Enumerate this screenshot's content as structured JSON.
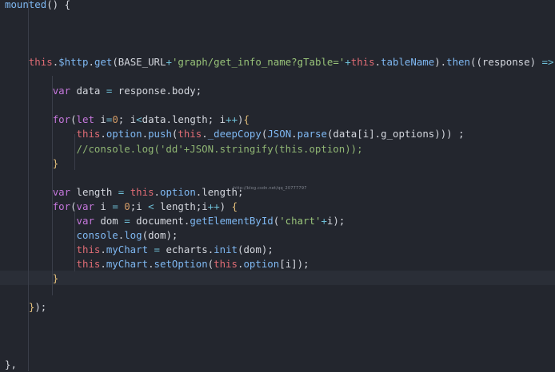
{
  "watermark": "http://blog.csdn.net/qq_20777797",
  "code_lines": [
    {
      "tokens": [
        [
          "fn",
          "mounted"
        ],
        [
          "pu",
          "() {"
        ]
      ]
    },
    {
      "tokens": []
    },
    {
      "tokens": []
    },
    {
      "tokens": []
    },
    {
      "tokens": [
        [
          "pl",
          "    "
        ],
        [
          "th",
          "this"
        ],
        [
          "pu",
          "."
        ],
        [
          "fn",
          "$http"
        ],
        [
          "pu",
          "."
        ],
        [
          "fn",
          "get"
        ],
        [
          "pu",
          "("
        ],
        [
          "pl",
          "BASE_URL"
        ],
        [
          "op",
          "+"
        ],
        [
          "st",
          "'graph/get_info_name?gTable='"
        ],
        [
          "op",
          "+"
        ],
        [
          "th",
          "this"
        ],
        [
          "pu",
          "."
        ],
        [
          "fn",
          "tableName"
        ],
        [
          "pu",
          ")."
        ],
        [
          "fn",
          "then"
        ],
        [
          "pu",
          "(("
        ],
        [
          "pl",
          "response"
        ],
        [
          "pu",
          ") "
        ],
        [
          "op",
          "=>"
        ],
        [
          "pu",
          " "
        ],
        [
          "yb",
          "{"
        ]
      ]
    },
    {
      "tokens": []
    },
    {
      "tokens": [
        [
          "pl",
          "        "
        ],
        [
          "kw",
          "var"
        ],
        [
          "pl",
          " data "
        ],
        [
          "op",
          "="
        ],
        [
          "pl",
          " response"
        ],
        [
          "pu",
          "."
        ],
        [
          "pl",
          "body"
        ],
        [
          "pu",
          ";"
        ]
      ]
    },
    {
      "tokens": []
    },
    {
      "tokens": [
        [
          "pl",
          "        "
        ],
        [
          "kw",
          "for"
        ],
        [
          "pu",
          "("
        ],
        [
          "kw",
          "let"
        ],
        [
          "pl",
          " i"
        ],
        [
          "op",
          "="
        ],
        [
          "nm",
          "0"
        ],
        [
          "pu",
          "; "
        ],
        [
          "pl",
          "i"
        ],
        [
          "op",
          "<"
        ],
        [
          "pl",
          "data"
        ],
        [
          "pu",
          "."
        ],
        [
          "pl",
          "length"
        ],
        [
          "pu",
          "; "
        ],
        [
          "pl",
          "i"
        ],
        [
          "op",
          "++"
        ],
        [
          "pu",
          ")"
        ],
        [
          "yb",
          "{"
        ]
      ]
    },
    {
      "tokens": [
        [
          "pl",
          "            "
        ],
        [
          "th",
          "this"
        ],
        [
          "pu",
          "."
        ],
        [
          "fn",
          "option"
        ],
        [
          "pu",
          "."
        ],
        [
          "fn",
          "push"
        ],
        [
          "pu",
          "("
        ],
        [
          "th",
          "this"
        ],
        [
          "pu",
          "."
        ],
        [
          "fn",
          "_deepCopy"
        ],
        [
          "pu",
          "("
        ],
        [
          "gl",
          "JSON"
        ],
        [
          "pu",
          "."
        ],
        [
          "fn",
          "parse"
        ],
        [
          "pu",
          "("
        ],
        [
          "pl",
          "data"
        ],
        [
          "pu",
          "["
        ],
        [
          "pl",
          "i"
        ],
        [
          "pu",
          "]."
        ],
        [
          "pl",
          "g_options"
        ],
        [
          "pu",
          "))) ;"
        ]
      ]
    },
    {
      "tokens": [
        [
          "pl",
          "            "
        ],
        [
          "cm",
          "//console.log('dd'+JSON.stringify(this.option));"
        ]
      ]
    },
    {
      "tokens": [
        [
          "pl",
          "        "
        ],
        [
          "yb",
          "}"
        ]
      ]
    },
    {
      "tokens": []
    },
    {
      "tokens": [
        [
          "pl",
          "        "
        ],
        [
          "kw",
          "var"
        ],
        [
          "pl",
          " length "
        ],
        [
          "op",
          "="
        ],
        [
          "pl",
          " "
        ],
        [
          "th",
          "this"
        ],
        [
          "pu",
          "."
        ],
        [
          "fn",
          "option"
        ],
        [
          "pu",
          "."
        ],
        [
          "pl",
          "length"
        ],
        [
          "pu",
          ";"
        ]
      ]
    },
    {
      "tokens": [
        [
          "pl",
          "        "
        ],
        [
          "kw",
          "for"
        ],
        [
          "pu",
          "("
        ],
        [
          "kw",
          "var"
        ],
        [
          "pl",
          " i "
        ],
        [
          "op",
          "="
        ],
        [
          "pl",
          " "
        ],
        [
          "nm",
          "0"
        ],
        [
          "pu",
          ";"
        ],
        [
          "pl",
          "i "
        ],
        [
          "op",
          "<"
        ],
        [
          "pl",
          " length"
        ],
        [
          "pu",
          ";"
        ],
        [
          "pl",
          "i"
        ],
        [
          "op",
          "++"
        ],
        [
          "pu",
          ") "
        ],
        [
          "yb",
          "{"
        ]
      ]
    },
    {
      "tokens": [
        [
          "pl",
          "            "
        ],
        [
          "kw",
          "var"
        ],
        [
          "pl",
          " dom "
        ],
        [
          "op",
          "="
        ],
        [
          "pl",
          " document"
        ],
        [
          "pu",
          "."
        ],
        [
          "fn",
          "getElementById"
        ],
        [
          "pu",
          "("
        ],
        [
          "st",
          "'chart'"
        ],
        [
          "op",
          "+"
        ],
        [
          "pl",
          "i"
        ],
        [
          "pu",
          ");"
        ]
      ]
    },
    {
      "tokens": [
        [
          "pl",
          "            "
        ],
        [
          "gl",
          "console"
        ],
        [
          "pu",
          "."
        ],
        [
          "fn",
          "log"
        ],
        [
          "pu",
          "("
        ],
        [
          "pl",
          "dom"
        ],
        [
          "pu",
          ");"
        ]
      ]
    },
    {
      "tokens": [
        [
          "pl",
          "            "
        ],
        [
          "th",
          "this"
        ],
        [
          "pu",
          "."
        ],
        [
          "fn",
          "myChart"
        ],
        [
          "pl",
          " "
        ],
        [
          "op",
          "="
        ],
        [
          "pl",
          " echarts"
        ],
        [
          "pu",
          "."
        ],
        [
          "fn",
          "init"
        ],
        [
          "pu",
          "("
        ],
        [
          "pl",
          "dom"
        ],
        [
          "pu",
          ");"
        ]
      ]
    },
    {
      "tokens": [
        [
          "pl",
          "            "
        ],
        [
          "th",
          "this"
        ],
        [
          "pu",
          "."
        ],
        [
          "fn",
          "myChart"
        ],
        [
          "pu",
          "."
        ],
        [
          "fn",
          "setOption"
        ],
        [
          "pu",
          "("
        ],
        [
          "th",
          "this"
        ],
        [
          "pu",
          "."
        ],
        [
          "fn",
          "option"
        ],
        [
          "pu",
          "["
        ],
        [
          "pl",
          "i"
        ],
        [
          "pu",
          "]);"
        ]
      ]
    },
    {
      "tokens": [
        [
          "pl",
          "        "
        ],
        [
          "yb",
          "}"
        ]
      ]
    },
    {
      "tokens": []
    },
    {
      "tokens": [
        [
          "pl",
          "    "
        ],
        [
          "yb",
          "}"
        ],
        [
          "pu",
          ");"
        ]
      ]
    },
    {
      "tokens": []
    },
    {
      "tokens": []
    },
    {
      "tokens": []
    },
    {
      "tokens": [
        [
          "pu",
          "},"
        ]
      ]
    }
  ]
}
